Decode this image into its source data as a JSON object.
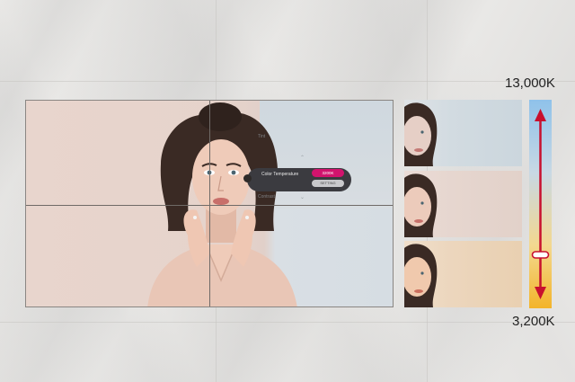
{
  "scale": {
    "max_label": "13,000K",
    "min_label": "3,200K",
    "slider_position": 0.16
  },
  "osd": {
    "color_temperature_label": "Color Temperature",
    "value": "3200K",
    "setting_button": "SETTING",
    "item_above": "Tint",
    "item_below": "Contrast"
  },
  "colors": {
    "accent": "#d1136d",
    "arrow": "#c8102e",
    "cool_bar_top": "#8fc2ea",
    "warm_bar_bottom": "#f3b42a"
  },
  "icons": [
    "up-arrow-icon",
    "down-arrow-icon",
    "slider-handle-icon"
  ]
}
